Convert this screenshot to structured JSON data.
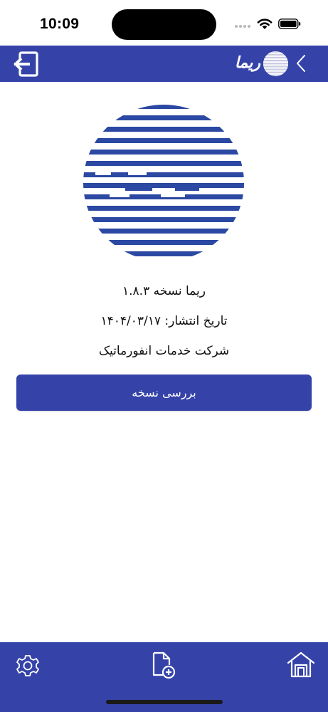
{
  "status_bar": {
    "time": "10:09",
    "icons": [
      "signal-dots-icon",
      "wifi-icon",
      "battery-icon"
    ]
  },
  "header": {
    "title": "ریما",
    "back_icon": "chevron-left-icon",
    "logout_icon": "logout-icon",
    "logo_icon": "rima-logo-icon"
  },
  "about": {
    "version": "ریما نسخه ۱.۸.۳",
    "release_date": "تاریخ انتشار: ۱۴۰۴/۰۳/۱۷",
    "company": "شرکت خدمات انفورماتیک"
  },
  "check_version_button": {
    "label": "بررسی نسخه"
  },
  "bottom_nav": {
    "items": [
      {
        "icon": "gear-icon"
      },
      {
        "icon": "new-document-icon"
      },
      {
        "icon": "home-icon"
      }
    ]
  },
  "colors": {
    "primary": "#3543a9",
    "background": "#ffffff",
    "text": "#111111"
  }
}
